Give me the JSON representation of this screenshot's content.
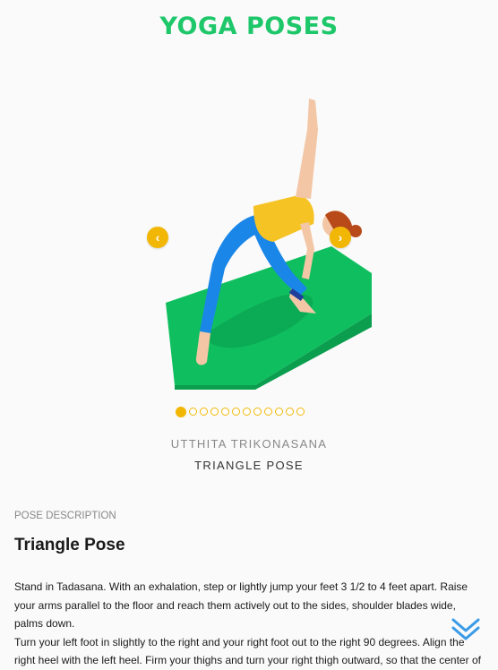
{
  "header": {
    "title": "YOGA POSES"
  },
  "carousel": {
    "prev_icon": "chevron-left-icon",
    "next_icon": "chevron-right-icon",
    "prev_glyph": "‹",
    "next_glyph": "›",
    "slide_count": 12,
    "active_index": 0
  },
  "pose": {
    "sanskrit_name": "UTTHITA TRIKONASANA",
    "english_name": "TRIANGLE POSE"
  },
  "description": {
    "section_label": "POSE DESCRIPTION",
    "heading": "Triangle Pose",
    "paragraphs": [
      "Stand in Tadasana. With an exhalation, step or lightly jump your feet 3 1/2 to 4 feet apart. Raise your arms parallel to the floor and reach them actively out to the sides, shoulder blades wide, palms down.",
      "Turn your left foot in slightly to the right and your right foot out to the right 90 degrees. Align the right heel with the left heel. Firm your thighs and turn your right thigh outward, so that the center of"
    ]
  },
  "scroll_indicator": {
    "icon": "double-chevron-down-icon"
  },
  "colors": {
    "accent_green": "#1ec76a",
    "accent_yellow": "#f2b705",
    "mat_green": "#0fbf5f"
  }
}
